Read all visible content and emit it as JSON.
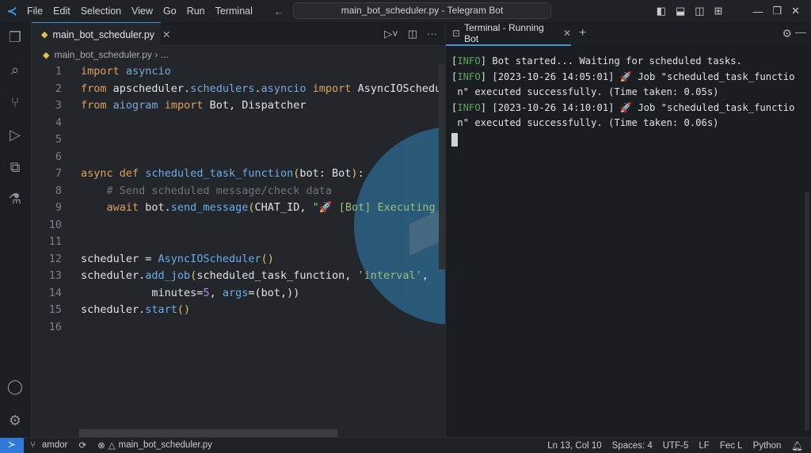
{
  "window": {
    "title": "main_bot_scheduler.py - Telegram Bot",
    "menu": [
      "File",
      "Edit",
      "Selection",
      "View",
      "Go",
      "Run",
      "Terminal"
    ]
  },
  "editor": {
    "tab_label": "main_bot_scheduler.py",
    "breadcrumb": "main_bot_scheduler.py",
    "breadcrumb_more": "...",
    "lines": [
      [
        [
          "import",
          "kw"
        ],
        [
          " ",
          "tx"
        ],
        [
          "asyncio",
          "mod"
        ]
      ],
      [
        [
          "from",
          "kw"
        ],
        [
          " apscheduler.",
          "tx"
        ],
        [
          "schedulers",
          "mod"
        ],
        [
          ".",
          "tx"
        ],
        [
          "asyncio",
          "mod"
        ],
        [
          " ",
          "tx"
        ],
        [
          "import",
          "kw"
        ],
        [
          " AsyncIOSchedul",
          "tx"
        ]
      ],
      [
        [
          "from",
          "kw"
        ],
        [
          " ",
          "tx"
        ],
        [
          "aiogram",
          "mod"
        ],
        [
          " ",
          "tx"
        ],
        [
          "import",
          "kw"
        ],
        [
          " Bot, Dispatcher",
          "tx"
        ]
      ],
      [],
      [],
      [],
      [
        [
          "async",
          "kw"
        ],
        [
          " ",
          "tx"
        ],
        [
          "def",
          "kw"
        ],
        [
          " ",
          "tx"
        ],
        [
          "scheduled_task_function",
          "fn"
        ],
        [
          "(",
          "pn"
        ],
        [
          "bot: Bot",
          "tx"
        ],
        [
          ")",
          "pn"
        ],
        [
          ":",
          "tx"
        ]
      ],
      [
        [
          "    # Send scheduled message/check data",
          "cm"
        ]
      ],
      [
        [
          "    ",
          "tx"
        ],
        [
          "await",
          "kw"
        ],
        [
          " bot.",
          "tx"
        ],
        [
          "send_message",
          "fn"
        ],
        [
          "(",
          "pn"
        ],
        [
          "CHAT_ID, ",
          "tx"
        ],
        [
          "\"🚀 [Bot] Executing s",
          "str"
        ]
      ],
      [],
      [],
      [
        [
          "scheduler = ",
          "tx"
        ],
        [
          "AsyncIOScheduler",
          "fn"
        ],
        [
          "()",
          "pn"
        ]
      ],
      [
        [
          "scheduler.",
          "tx"
        ],
        [
          "add_job",
          "fn"
        ],
        [
          "(",
          "pn"
        ],
        [
          "scheduled_task_function, ",
          "tx"
        ],
        [
          "'interval'",
          "str"
        ],
        [
          ",",
          "tx"
        ]
      ],
      [
        [
          "           minutes=",
          "tx"
        ],
        [
          "5",
          "num"
        ],
        [
          ", ",
          "tx"
        ],
        [
          "args",
          "fn"
        ],
        [
          "=(",
          "tx"
        ],
        [
          "bot,))",
          "tx"
        ]
      ],
      [
        [
          "scheduler.",
          "tx"
        ],
        [
          "start",
          "fn"
        ],
        [
          "()",
          "pn"
        ]
      ],
      []
    ]
  },
  "terminal": {
    "tab_label": "Terminal - Running Bot",
    "lines": [
      {
        "tag": "INFO",
        "text": " Bot started... Waiting for scheduled tasks."
      },
      {
        "tag": "INFO",
        "text": " [2023-10-26 14:05:01] 🚀 Job \"scheduled_task_functio"
      },
      {
        "tag": "",
        "text": " n\" executed successfully. (Time taken: 0.05s)"
      },
      {
        "tag": "INFO",
        "text": " [2023-10-26 14:10:01] 🚀 Job \"scheduled_task_functio"
      },
      {
        "tag": "",
        "text": " n\" executed successfully. (Time taken: 0.06s)"
      }
    ]
  },
  "status": {
    "branch": "amdor",
    "file": "main_bot_scheduler.py",
    "position": "Ln 13, Col 10",
    "spaces": "Spaces: 4",
    "encoding": "UTF-5",
    "eol": "LF",
    "format": "Fec L",
    "language": "Python"
  }
}
